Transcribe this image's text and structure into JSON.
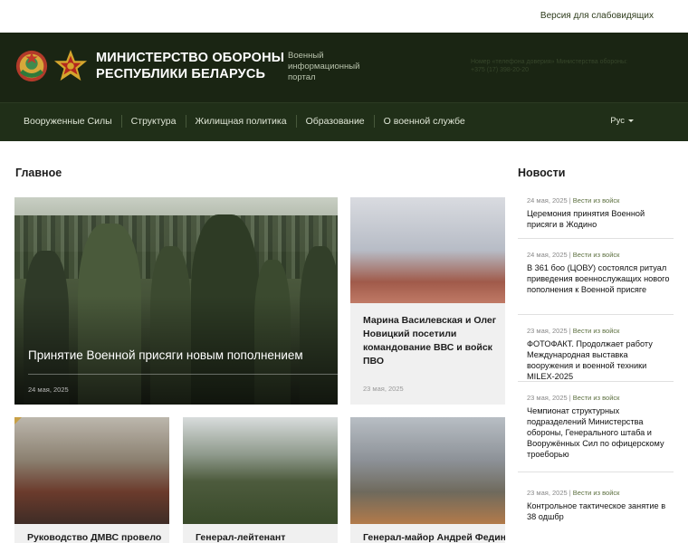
{
  "topbar": {
    "vision_link": "Версия для слабовидящих"
  },
  "header": {
    "title_line1": "МИНИСТЕРСТВО ОБОРОНЫ",
    "title_line2": "РЕСПУБЛИКИ БЕЛАРУСЬ",
    "subtitle_line1": "Военный",
    "subtitle_line2": "информационный",
    "subtitle_line3": "портал",
    "hotline_line1": "Номер «телефона доверия» Министерства обороны:",
    "hotline_line2": "+375 (17) 398-20-20"
  },
  "nav": {
    "items": [
      {
        "label": "Вооруженные Силы"
      },
      {
        "label": "Структура"
      },
      {
        "label": "Жилищная политика"
      },
      {
        "label": "Образование"
      },
      {
        "label": "О военной службе"
      }
    ],
    "lang": "Рус"
  },
  "main": {
    "title": "Главное",
    "feature": {
      "caption": "Принятие Военной присяги новым пополнением",
      "date": "24 мая, 2025"
    },
    "feature2": {
      "caption": "Марина Василевская и Олег Новицкий посетили командование ВВС и войск ПВО",
      "date": "23 мая, 2025"
    },
    "row": [
      {
        "caption": "Руководство ДМВС провело"
      },
      {
        "caption": "Генерал-лейтенант"
      },
      {
        "caption": "Генерал-майор Андрей Федин"
      }
    ]
  },
  "news": {
    "title": "Новости",
    "items": [
      {
        "date": "24 мая, 2025",
        "sep": " | ",
        "category": "Вести из войск",
        "title": "Церемония принятия Военной присяги в Жодино"
      },
      {
        "date": "24 мая, 2025",
        "sep": " | ",
        "category": "Вести из войск",
        "title": "В 361 боо (ЦОВУ) состоялся ритуал приведения военнослужащих нового пополнения к Военной присяге"
      },
      {
        "date": "23 мая, 2025",
        "sep": " | ",
        "category": "Вести из войск",
        "title": "ФОТОФАКТ. Продолжает работу Международная выставка вооружения и военной техники MILEX-2025"
      },
      {
        "date": "23 мая, 2025",
        "sep": " | ",
        "category": "Вести из войск",
        "title": "Чемпионат структурных подразделений Министерства обороны, Генерального штаба и Вооружённых Сил по офицерскому троеборью"
      },
      {
        "date": "23 мая, 2025",
        "sep": " | ",
        "category": "Вести из войск",
        "title": "Контрольное тактическое занятие в 38 одшбр"
      }
    ]
  },
  "colors": {
    "header_bg": "#1a2513",
    "nav_bg": "#202f18",
    "accent": "#5d7040",
    "gold": "#c8a046"
  }
}
